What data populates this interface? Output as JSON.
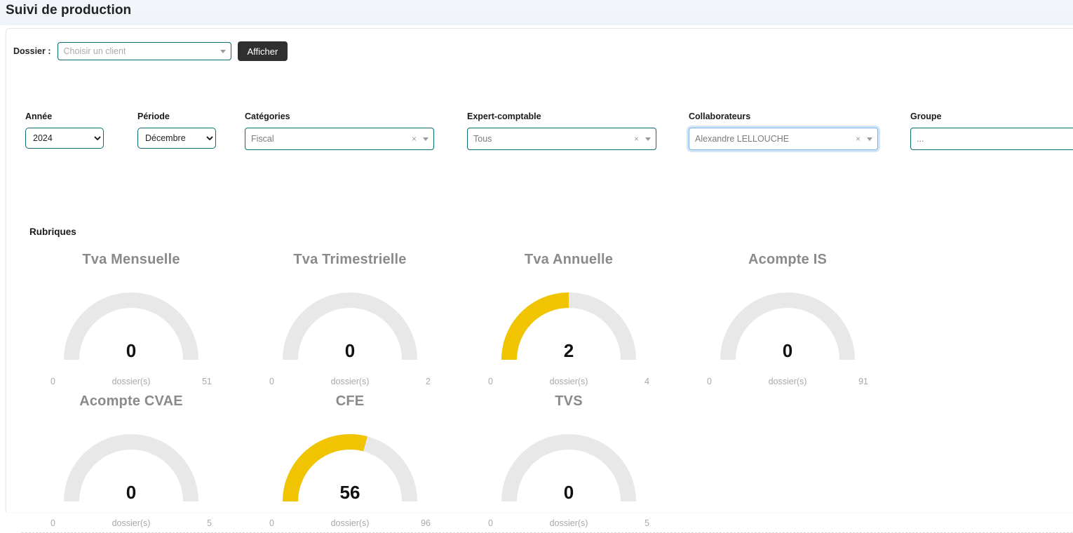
{
  "page": {
    "title": "Suivi de production"
  },
  "dossier": {
    "label": "Dossier :",
    "placeholder": "Choisir un client",
    "value": "",
    "button_label": "Afficher"
  },
  "filters": [
    {
      "name": "annee",
      "label": "Année",
      "type": "select",
      "value": "2024",
      "options": [
        "2024"
      ]
    },
    {
      "name": "periode",
      "label": "Période",
      "type": "select",
      "value": "Décembre",
      "options": [
        "Décembre"
      ]
    },
    {
      "name": "categories",
      "label": "Catégories",
      "type": "select2",
      "value": "Fiscal",
      "clearable": true,
      "focused": false
    },
    {
      "name": "expert",
      "label": "Expert-comptable",
      "type": "select2",
      "value": "Tous",
      "clearable": true,
      "focused": false
    },
    {
      "name": "collab",
      "label": "Collaborateurs",
      "type": "select2",
      "value": "Alexandre LELLOUCHE",
      "clearable": true,
      "focused": true
    },
    {
      "name": "groupe",
      "label": "Groupe",
      "type": "select2",
      "value": "...",
      "clearable": false,
      "focused": false
    }
  ],
  "rubriques": {
    "heading": "Rubriques",
    "unit_label": "dossier(s)",
    "track_color": "#e8e8e8",
    "fill_color": "#f0c400",
    "gauges": [
      {
        "title": "Tva Mensuelle",
        "value": 0,
        "min": 0,
        "max": 51,
        "min_label": "0",
        "max_label": "51",
        "unit": "dossier(s)"
      },
      {
        "title": "Tva Trimestrielle",
        "value": 0,
        "min": 0,
        "max": 2,
        "min_label": "0",
        "max_label": "2",
        "unit": "dossier(s)"
      },
      {
        "title": "Tva Annuelle",
        "value": 2,
        "min": 0,
        "max": 4,
        "min_label": "0",
        "max_label": "4",
        "unit": "dossier(s)"
      },
      {
        "title": "Acompte IS",
        "value": 0,
        "min": 0,
        "max": 91,
        "min_label": "0",
        "max_label": "91",
        "unit": "dossier(s)"
      },
      {
        "title": "Acompte CVAE",
        "value": 0,
        "min": 0,
        "max": 5,
        "min_label": "0",
        "max_label": "5",
        "unit": "dossier(s)"
      },
      {
        "title": "CFE",
        "value": 56,
        "min": 0,
        "max": 96,
        "min_label": "0",
        "max_label": "96",
        "unit": "dossier(s)"
      },
      {
        "title": "TVS",
        "value": 0,
        "min": 0,
        "max": 5,
        "min_label": "0",
        "max_label": "5",
        "unit": "dossier(s)"
      }
    ]
  }
}
